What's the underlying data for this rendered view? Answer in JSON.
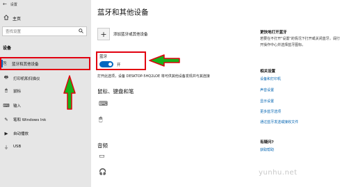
{
  "window": {
    "back_glyph": "←",
    "title": "设置"
  },
  "sidebar": {
    "home": {
      "icon": "home-icon",
      "label": "主页"
    },
    "search": {
      "placeholder": "查找设置",
      "icon": "search-icon"
    },
    "group_label": "设备",
    "items": [
      {
        "icon": "bluetooth-devices-icon",
        "glyph": "⎘",
        "label": "蓝牙和其他设备",
        "active": true
      },
      {
        "icon": "printer-icon",
        "glyph": "🖶",
        "label": "打印机和扫描仪"
      },
      {
        "icon": "mouse-icon",
        "glyph": "🖱",
        "label": "鼠标"
      },
      {
        "icon": "keyboard-icon",
        "glyph": "⌨",
        "label": "输入"
      },
      {
        "icon": "pen-icon",
        "glyph": "✎",
        "label": "笔和 Windows Ink"
      },
      {
        "icon": "autoplay-icon",
        "glyph": "▶",
        "label": "自动播放"
      },
      {
        "icon": "usb-icon",
        "glyph": "⏚",
        "label": "USB"
      }
    ]
  },
  "main": {
    "title": "蓝牙和其他设备",
    "add_button_glyph": "+",
    "add_label": "添加蓝牙或其他设备",
    "bluetooth": {
      "label": "蓝牙",
      "state": "开",
      "on": true
    },
    "discover_text": "打开此选项，设备 DESKTOP-5HQ2LOE 将可供其他设备发现并与其连接",
    "sections": [
      {
        "title": "鼠标、键盘和笔",
        "devices": [
          {
            "icon": "keyboard-device-icon",
            "glyph": "⌨"
          },
          {
            "icon": "mouse-device-icon",
            "glyph": "🖱"
          }
        ]
      },
      {
        "title": "音频",
        "devices": [
          {
            "icon": "monitor-device-icon",
            "glyph": "▭"
          },
          {
            "icon": "headphones-device-icon",
            "glyph": "🎧"
          }
        ]
      }
    ]
  },
  "right_panel": {
    "faster_title": "更快地打开蓝牙",
    "faster_text": "若要在不打开\"设置\"的情况下打开或关闭蓝牙，请打开操作中心并选择蓝牙图标。",
    "related_title": "相关设置",
    "links": [
      "设备和打印机",
      "声音设置",
      "显示设置",
      "更多蓝牙选项",
      "通过蓝牙发送或接收文件"
    ],
    "question_title": "有疑问?",
    "help_link": "获取帮助"
  },
  "watermark": "yunhu.net",
  "colors": {
    "accent": "#0067c0",
    "highlight_red": "#e2000f",
    "arrow_fill": "#17b21a",
    "sidebar_bg": "#e6e6e6"
  }
}
